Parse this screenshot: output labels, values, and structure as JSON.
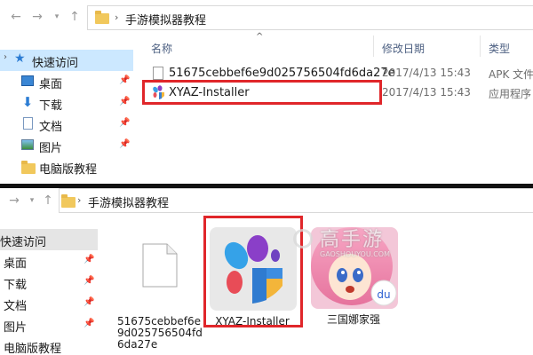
{
  "top": {
    "path": [
      "手游模拟器教程"
    ],
    "sidebar": [
      {
        "label": "快速访问",
        "icon": "star-icon",
        "selected": true
      },
      {
        "label": "桌面",
        "icon": "desktop-icon",
        "pinned": true
      },
      {
        "label": "下载",
        "icon": "download-icon",
        "pinned": true
      },
      {
        "label": "文档",
        "icon": "document-icon",
        "pinned": true
      },
      {
        "label": "图片",
        "icon": "picture-icon",
        "pinned": true
      },
      {
        "label": "电脑版教程",
        "icon": "folder-icon"
      }
    ],
    "columns": {
      "name": "名称",
      "date": "修改日期",
      "type": "类型"
    },
    "files": [
      {
        "name": "51675cebbef6e9d025756504fd6da27e",
        "date": "2017/4/13 15:43",
        "type": "APK 文件",
        "icon": "file-icon"
      },
      {
        "name": "XYAZ-Installer",
        "date": "2017/4/13 15:43",
        "type": "应用程序",
        "icon": "xyaz-app-icon",
        "highlighted": true
      }
    ]
  },
  "bottom": {
    "path": [
      "手游模拟器教程"
    ],
    "sidebar": [
      {
        "label": "快速访问",
        "selected": true
      },
      {
        "label": "桌面",
        "pinned": true
      },
      {
        "label": "下载",
        "pinned": true
      },
      {
        "label": "文档",
        "pinned": true
      },
      {
        "label": "图片",
        "pinned": true
      },
      {
        "label": "电脑版教程"
      }
    ],
    "tiles": [
      {
        "name": "51675cebbef6e9d025756504fd6da27e",
        "icon": "blank-file-icon"
      },
      {
        "name": "XYAZ-Installer",
        "icon": "xyaz-app-icon",
        "highlighted": true
      },
      {
        "name": "三国娜家强",
        "icon": "game-app-icon"
      }
    ],
    "watermark": {
      "brand": "高手游",
      "site": "GAOSHOUYOU.COM"
    }
  },
  "colors": {
    "highlight": "#e0262a",
    "selection": "#cce8ff",
    "folder": "#f1c85c"
  }
}
